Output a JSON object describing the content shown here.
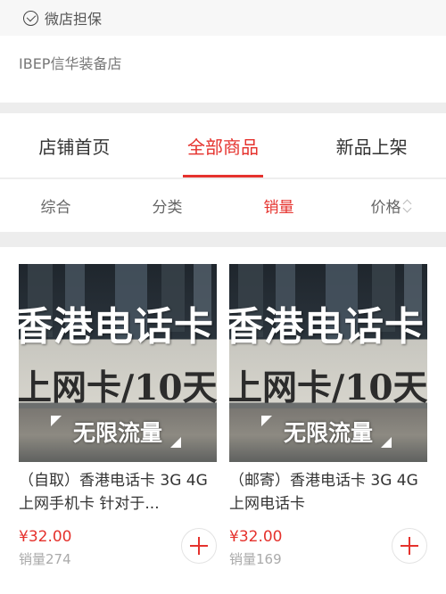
{
  "guarantee": {
    "icon": "check-circle-icon",
    "label": "微店担保"
  },
  "store": {
    "name": "IBEP信华装备店"
  },
  "tabs": [
    {
      "label": "店铺首页",
      "active": false
    },
    {
      "label": "全部商品",
      "active": true
    },
    {
      "label": "新品上架",
      "active": false
    }
  ],
  "sort": {
    "items": [
      {
        "label": "综合",
        "active": false
      },
      {
        "label": "分类",
        "active": false
      },
      {
        "label": "销量",
        "active": true
      },
      {
        "label": "价格",
        "active": false,
        "icon": "sort-updown-icon"
      }
    ]
  },
  "products": [
    {
      "image_text": {
        "line1": "香港电话卡",
        "line2": "上网卡/10天",
        "line3": "无限流量"
      },
      "title": "（自取）香港电话卡 3G 4G上网手机卡 针对于...",
      "price": "¥32.00",
      "sold": "销量274"
    },
    {
      "image_text": {
        "line1": "香港电话卡",
        "line2": "上网卡/10天",
        "line3": "无限流量"
      },
      "title": "（邮寄）香港电话卡 3G 4G上网电话卡",
      "price": "¥32.00",
      "sold": "销量169"
    }
  ],
  "colors": {
    "accent": "#e5322d",
    "text": "#333333",
    "muted": "#aaaaaa",
    "background": "#ededed"
  }
}
